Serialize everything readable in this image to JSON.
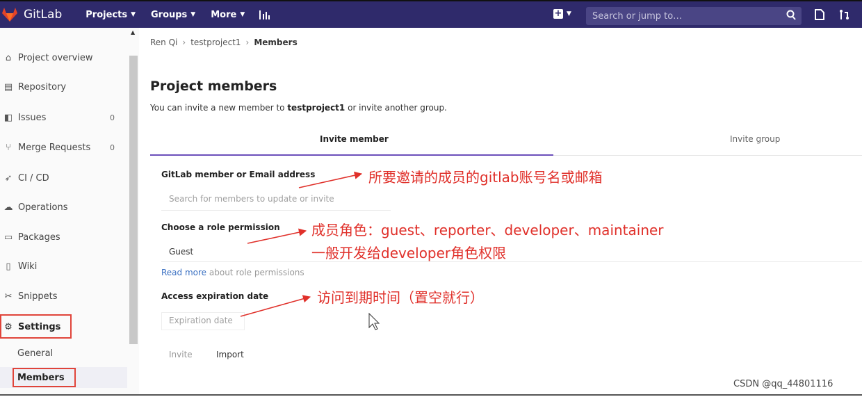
{
  "topbar": {
    "brand": "GitLab",
    "nav": [
      "Projects",
      "Groups",
      "More"
    ],
    "search_placeholder": "Search or jump to…"
  },
  "sidebar": {
    "items": [
      {
        "label": "Project overview",
        "icon": "home-icon"
      },
      {
        "label": "Repository",
        "icon": "doc-icon"
      },
      {
        "label": "Issues",
        "icon": "issues-icon",
        "count": "0"
      },
      {
        "label": "Merge Requests",
        "icon": "merge-icon",
        "count": "0"
      },
      {
        "label": "CI / CD",
        "icon": "rocket-icon"
      },
      {
        "label": "Operations",
        "icon": "cloud-icon"
      },
      {
        "label": "Packages",
        "icon": "package-icon"
      },
      {
        "label": "Wiki",
        "icon": "book-icon"
      },
      {
        "label": "Snippets",
        "icon": "scissors-icon"
      },
      {
        "label": "Settings",
        "icon": "gear-icon"
      }
    ],
    "sub_items": [
      "General",
      "Members"
    ]
  },
  "breadcrumb": [
    "Ren Qi",
    "testproject1",
    "Members"
  ],
  "main": {
    "title": "Project members",
    "desc_prefix": "You can invite a new member to ",
    "desc_project": "testproject1",
    "desc_suffix": " or invite another group.",
    "tabs": [
      "Invite member",
      "Invite group"
    ],
    "member_label": "GitLab member or Email address",
    "member_placeholder": "Search for members to update or invite",
    "role_label": "Choose a role permission",
    "role_value": "Guest",
    "read_more_link": "Read more",
    "read_more_text": " about role permissions",
    "expiry_label": "Access expiration date",
    "expiry_placeholder": "Expiration date",
    "invite_button": "Invite",
    "import_button": "Import"
  },
  "annotations": {
    "note1": "所要邀请的成员的gitlab账号名或邮箱",
    "note2_line1": "成员角色：guest、reporter、developer、maintainer",
    "note2_line2": "一般开发给developer角色权限",
    "note3": "访问到期时间（置空就行）",
    "color": "#e0302a"
  },
  "watermark": "CSDN @qq_44801116"
}
